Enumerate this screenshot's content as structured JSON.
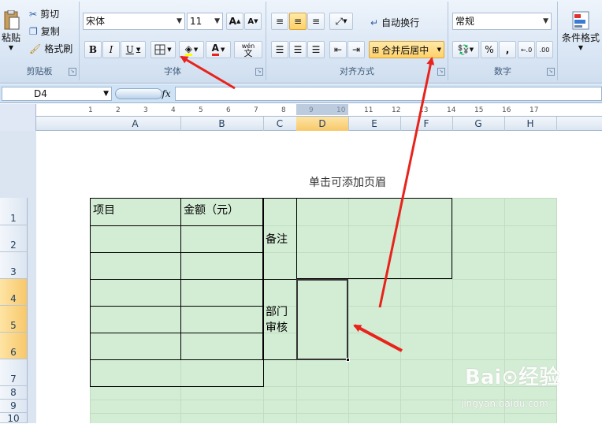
{
  "ribbon": {
    "clipboard": {
      "paste": "粘贴",
      "cut": "剪切",
      "copy": "复制",
      "format_painter": "格式刷",
      "title": "剪贴板"
    },
    "font": {
      "name": "宋体",
      "size": "11",
      "bold": "B",
      "italic": "I",
      "underline": "U",
      "title": "字体",
      "grow": "A",
      "shrink": "A",
      "phonetic": "wén",
      "phonetic_char": "文"
    },
    "alignment": {
      "wrap": "自动换行",
      "merge": "合并后居中",
      "title": "对齐方式"
    },
    "number": {
      "format": "常规",
      "percent": "%",
      "comma": ",",
      "inc_dec": ".00",
      "title": "数字"
    },
    "styles": {
      "conditional": "条件格式"
    }
  },
  "formula_bar": {
    "name_box": "D4",
    "fx": "fx"
  },
  "columns": [
    "A",
    "B",
    "C",
    "D",
    "E",
    "F",
    "G",
    "H"
  ],
  "rows": [
    "1",
    "2",
    "3",
    "4",
    "5",
    "6",
    "7",
    "8",
    "9",
    "10"
  ],
  "page": {
    "header_hint": "单击可添加页眉"
  },
  "table": {
    "item": "项目",
    "amount": "金额（元）",
    "remark": "备注",
    "dept_review_1": "部门",
    "dept_review_2": "审核"
  },
  "ruler": [
    "1",
    "2",
    "3",
    "4",
    "5",
    "6",
    "7",
    "8",
    "9",
    "10",
    "11",
    "12",
    "13",
    "14",
    "15",
    "16",
    "17"
  ],
  "watermark": {
    "logo": "Bai⊙经验",
    "url": "jingyan.baidu.com"
  },
  "colors": {
    "accent_arrow": "#e8231b",
    "sheet_bg": "#d3ecd4",
    "selected_header": "#f8c86a"
  }
}
